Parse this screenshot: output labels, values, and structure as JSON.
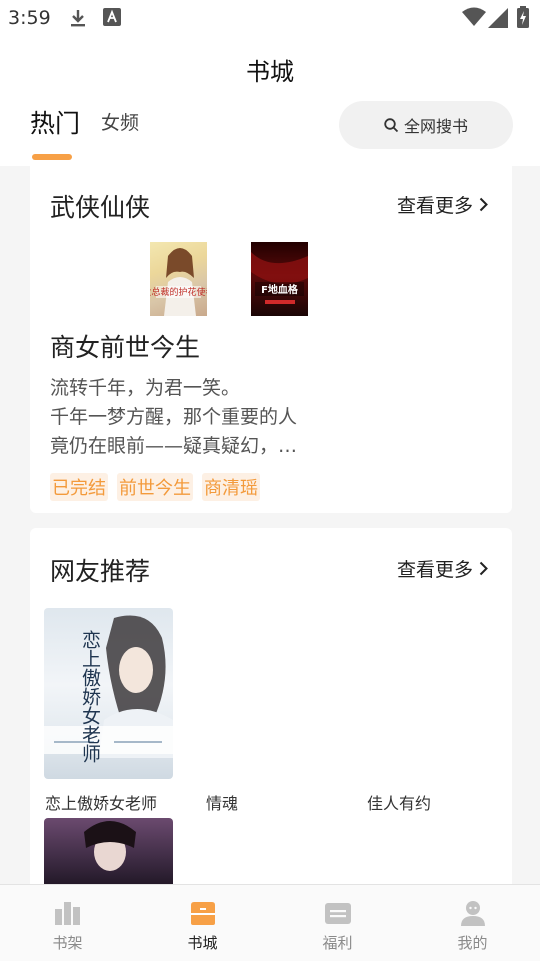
{
  "status_bar": {
    "time": "3:59"
  },
  "header": {
    "title": "书城",
    "tabs": [
      {
        "label": "热门",
        "active": true
      },
      {
        "label": "女频",
        "active": false
      }
    ],
    "search_label": "全网搜书"
  },
  "section_wuxia": {
    "title": "武侠仙侠",
    "more_label": "查看更多",
    "covers": [
      {
        "title_text": "女总裁的护花使者",
        "icon": "book-cover-romance"
      },
      {
        "title_text": "F地血格",
        "icon": "book-cover-dark"
      }
    ],
    "featured": {
      "title": "商女前世今生",
      "description": "流转千年，为君一笑。\n千年一梦方醒，那个重要的人\n竟仍在眼前——疑真疑幻，…",
      "tags": [
        "已完结",
        "前世今生",
        "商清瑶"
      ]
    }
  },
  "section_recommend": {
    "title": "网友推荐",
    "more_label": "查看更多",
    "books": [
      {
        "title": "恋上傲娇女老师",
        "cover_text": "恋上傲娇女老师"
      },
      {
        "title": "情魂"
      },
      {
        "title": "佳人有约"
      }
    ]
  },
  "tabbar": {
    "items": [
      {
        "label": "书架",
        "icon": "bookshelf-icon",
        "active": false
      },
      {
        "label": "书城",
        "icon": "bookstore-icon",
        "active": true
      },
      {
        "label": "福利",
        "icon": "welfare-icon",
        "active": false
      },
      {
        "label": "我的",
        "icon": "profile-icon",
        "active": false
      }
    ]
  },
  "colors": {
    "accent": "#f7a046",
    "tag_text": "#f39a3b",
    "tag_bg": "#fdf0e4"
  }
}
